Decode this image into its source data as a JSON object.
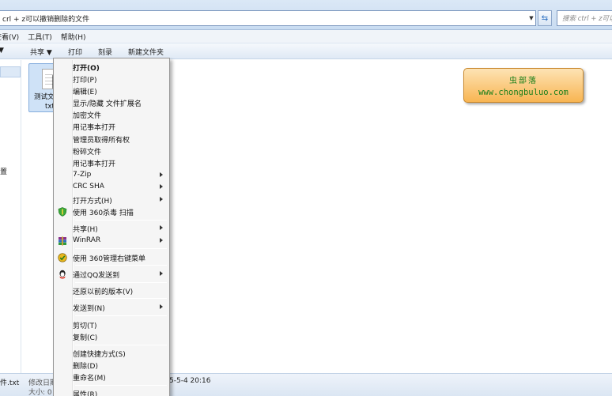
{
  "address_bar": {
    "path": "crl + z可以撤销删除的文件",
    "refresh_icon": "refresh-icon",
    "search_placeholder": "搜索 ctrl + z可以..."
  },
  "menubar": {
    "items": [
      "查看(V)",
      "工具(T)",
      "帮助(H)"
    ]
  },
  "toolbar": {
    "items": [
      "共享 ▼",
      "打印",
      "刻录",
      "新建文件夹"
    ]
  },
  "nav": {
    "partial_text": "置"
  },
  "file": {
    "name": "测试文",
    "ext": "txt"
  },
  "watermark": {
    "line1": "虫部落",
    "line2": "www.chongbuluo.com",
    "color": "#1a7f1a"
  },
  "details": {
    "name": "件.txt",
    "modified_label": "修改日期: 2",
    "size_label": "大小: 0",
    "date_tail": "5-5-4 20:16"
  },
  "context_menu": {
    "items": [
      {
        "label": "打开(O)",
        "bold": true
      },
      {
        "label": "打印(P)"
      },
      {
        "label": "编辑(E)"
      },
      {
        "label": "显示/隐藏 文件扩展名"
      },
      {
        "label": "加密文件"
      },
      {
        "label": "用记事本打开"
      },
      {
        "label": "管理员取得所有权"
      },
      {
        "label": "粉碎文件"
      },
      {
        "label": "用记事本打开"
      },
      {
        "label": "7-Zip",
        "submenu": true
      },
      {
        "label": "CRC SHA",
        "submenu": true
      },
      {
        "label": "打开方式(H)",
        "submenu": true
      },
      {
        "label": "使用 360杀毒 扫描",
        "icon": "360-shield-icon"
      },
      {
        "label": "共享(H)",
        "submenu": true
      },
      {
        "label": "WinRAR",
        "submenu": true,
        "icon": "winrar-icon"
      },
      {
        "label": "使用 360管理右键菜单",
        "icon": "360-manager-icon"
      },
      {
        "label": "通过QQ发送到",
        "submenu": true,
        "icon": "qq-icon"
      },
      {
        "label": "还原以前的版本(V)"
      },
      {
        "label": "发送到(N)",
        "submenu": true
      },
      {
        "label": "剪切(T)"
      },
      {
        "label": "复制(C)"
      },
      {
        "label": "创建快捷方式(S)"
      },
      {
        "label": "删除(D)"
      },
      {
        "label": "重命名(M)"
      },
      {
        "label": "属性(R)"
      }
    ]
  }
}
